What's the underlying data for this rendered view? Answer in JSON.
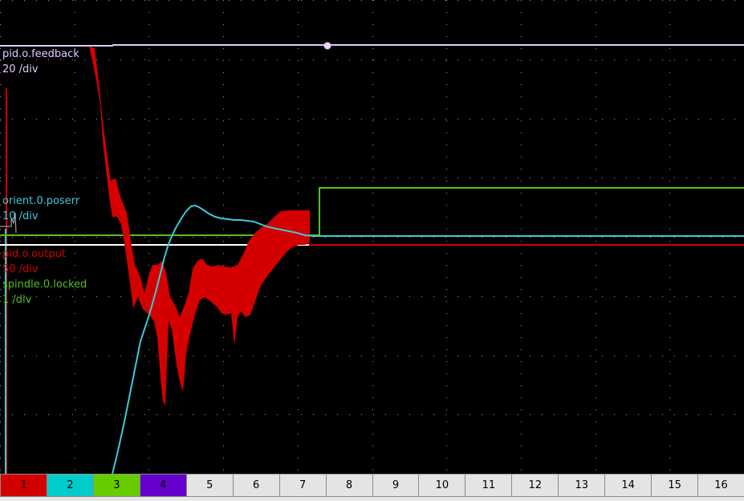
{
  "traces": [
    {
      "name": "pid.o.feedback",
      "scale": "20 /div",
      "color": "#e0c8ff"
    },
    {
      "name": "orient.0.poserr",
      "scale": "10 /div",
      "color": "#3ec8d8"
    },
    {
      "name": "pid.o.output",
      "scale": "50 /div",
      "color": "#d40000"
    },
    {
      "name": "spindle.0.locked",
      "scale": "1 /div",
      "color": "#55c020"
    }
  ],
  "channels": [
    {
      "label": "1",
      "color": "#d40000"
    },
    {
      "label": "2",
      "color": "#00cccc"
    },
    {
      "label": "3",
      "color": "#66cc00"
    },
    {
      "label": "4",
      "color": "#6600cc"
    },
    {
      "label": "5",
      "color": null
    },
    {
      "label": "6",
      "color": null
    },
    {
      "label": "7",
      "color": null
    },
    {
      "label": "8",
      "color": null
    },
    {
      "label": "9",
      "color": null
    },
    {
      "label": "10",
      "color": null
    },
    {
      "label": "11",
      "color": null
    },
    {
      "label": "12",
      "color": null
    },
    {
      "label": "13",
      "color": null
    },
    {
      "label": "14",
      "color": null
    },
    {
      "label": "15",
      "color": null
    },
    {
      "label": "16",
      "color": null
    }
  ],
  "colors": {
    "background": "#000000",
    "grid": "#ffffff",
    "white_trace": "#ffffff"
  }
}
